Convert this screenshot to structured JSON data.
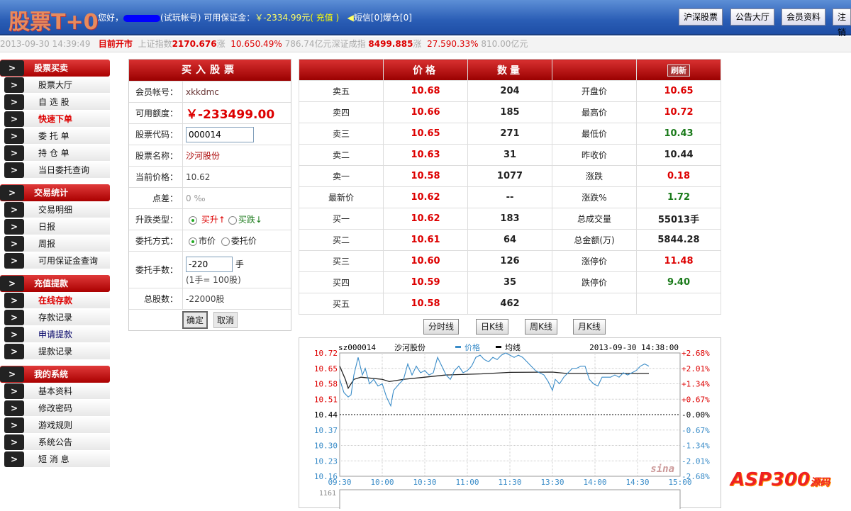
{
  "header": {
    "logo": "股票T+0",
    "greeting": "您好，",
    "account_type": "(试玩帐号)",
    "margin_label": "可用保证金：",
    "margin_value": "￥-2334.99元",
    "recharge": "( 充值 )",
    "messages": "短信[0]",
    "liquidation": "爆仓[0]",
    "buttons": [
      "沪深股票",
      "公告大厅",
      "会员资料",
      "注销"
    ]
  },
  "ticker": {
    "datetime": "2013-09-30 14:39:49",
    "status": "目前开市",
    "sh_label": "上证指数",
    "sh_value": "2170.676",
    "sh_dir": "涨",
    "sh_change": "10.650.49%",
    "sh_volume": "786.74亿元",
    "sz_label": "深证成指",
    "sz_value": "8499.885",
    "sz_dir": "涨",
    "sz_change": "27.590.33%",
    "sz_volume": "810.00亿元"
  },
  "sidebar": [
    {
      "title": "股票买卖",
      "items": [
        {
          "label": "股票大厅"
        },
        {
          "label": "自 选 股"
        },
        {
          "label": "快速下单",
          "style": "red"
        },
        {
          "label": "委 托 单"
        },
        {
          "label": "持 仓 单"
        },
        {
          "label": "当日委托查询"
        }
      ]
    },
    {
      "title": "交易统计",
      "items": [
        {
          "label": "交易明细"
        },
        {
          "label": "日报"
        },
        {
          "label": "周报"
        },
        {
          "label": "可用保证金查询"
        }
      ]
    },
    {
      "title": "充值提款",
      "items": [
        {
          "label": "在线存款",
          "style": "red"
        },
        {
          "label": "存款记录"
        },
        {
          "label": "申请提款",
          "style": "blue"
        },
        {
          "label": "提款记录"
        }
      ]
    },
    {
      "title": "我的系统",
      "items": [
        {
          "label": "基本资料"
        },
        {
          "label": "修改密码"
        },
        {
          "label": "游戏规则"
        },
        {
          "label": "系统公告"
        },
        {
          "label": "短 消 息"
        }
      ]
    }
  ],
  "buy": {
    "title": "买入股票",
    "account_label": "会员帐号：",
    "account": "xkkdmc",
    "quota_label": "可用额度：",
    "quota": "￥-233499.00",
    "code_label": "股票代码：",
    "code": "000014",
    "name_label": "股票名称：",
    "name": "沙河股份",
    "price_label": "当前价格：",
    "price": "10.62",
    "spread_label": "点差：",
    "spread": "0 ‰",
    "type_label": "升跌类型：",
    "type_up": "买升↑",
    "type_down": "买跌↓",
    "method_label": "委托方式：",
    "method_market": "市价",
    "method_limit": "委托价",
    "lots_label": "委托手数：",
    "lots": "-220",
    "lots_unit": "手",
    "lots_note": "(1手= 100股)",
    "total_label": "总股数：",
    "total": "-22000股",
    "confirm": "确定",
    "cancel": "取消"
  },
  "quote": {
    "headers": [
      "",
      "价格",
      "数量",
      "",
      "刷新"
    ],
    "rows": [
      {
        "l": "卖五",
        "p": "10.68",
        "q": "204",
        "k": "开盘价",
        "v": "10.65",
        "c": "pr"
      },
      {
        "l": "卖四",
        "p": "10.66",
        "q": "185",
        "k": "最高价",
        "v": "10.72",
        "c": "pr"
      },
      {
        "l": "卖三",
        "p": "10.65",
        "q": "271",
        "k": "最低价",
        "v": "10.43",
        "c": "pg"
      },
      {
        "l": "卖二",
        "p": "10.63",
        "q": "31",
        "k": "昨收价",
        "v": "10.44",
        "c": "pk"
      },
      {
        "l": "卖一",
        "p": "10.58",
        "q": "1077",
        "k": "涨跌",
        "v": "0.18",
        "c": "pr"
      },
      {
        "l": "最新价",
        "p": "10.62",
        "q": "--",
        "k": "涨跌%",
        "v": "1.72",
        "c": "pg"
      },
      {
        "l": "买一",
        "p": "10.62",
        "q": "183",
        "k": "总成交量",
        "v": "55013手",
        "c": "pk"
      },
      {
        "l": "买二",
        "p": "10.61",
        "q": "64",
        "k": "总金额(万)",
        "v": "5844.28",
        "c": "pk"
      },
      {
        "l": "买三",
        "p": "10.60",
        "q": "126",
        "k": "涨停价",
        "v": "11.48",
        "c": "pr"
      },
      {
        "l": "买四",
        "p": "10.59",
        "q": "35",
        "k": "跌停价",
        "v": "9.40",
        "c": "pg"
      },
      {
        "l": "买五",
        "p": "10.58",
        "q": "462",
        "k": "",
        "v": "",
        "c": "pk"
      }
    ]
  },
  "chart_tabs": [
    "分时线",
    "日K线",
    "周K线",
    "月K线"
  ],
  "chart_data": {
    "type": "line",
    "code": "sz000014",
    "name": "沙河股份",
    "legend": [
      "价格",
      "均线"
    ],
    "datetime": "2013-09-30 14:38:00",
    "y_ticks": [
      "10.72",
      "10.65",
      "10.58",
      "10.51",
      "10.44",
      "10.37",
      "10.30",
      "10.23",
      "10.16"
    ],
    "pct_ticks": [
      "+2.68%",
      "+2.01%",
      "+1.34%",
      "+0.67%",
      "-0.00%",
      "-0.67%",
      "-1.34%",
      "-2.01%",
      "-2.68%"
    ],
    "x_ticks": [
      "09:30",
      "10:00",
      "10:30",
      "11:00",
      "11:30",
      "13:30",
      "14:00",
      "14:30",
      "15:00"
    ],
    "ylim": [
      10.16,
      10.72
    ],
    "prev_close": 10.44,
    "volume_max": "1161",
    "watermark": "sina",
    "price": [
      [
        0,
        10.6
      ],
      [
        3,
        10.54
      ],
      [
        6,
        10.52
      ],
      [
        8,
        10.53
      ],
      [
        10,
        10.62
      ],
      [
        13,
        10.7
      ],
      [
        16,
        10.62
      ],
      [
        18,
        10.65
      ],
      [
        21,
        10.58
      ],
      [
        24,
        10.6
      ],
      [
        27,
        10.57
      ],
      [
        30,
        10.58
      ],
      [
        33,
        10.52
      ],
      [
        36,
        10.48
      ],
      [
        38,
        10.55
      ],
      [
        42,
        10.58
      ],
      [
        45,
        10.6
      ],
      [
        48,
        10.67
      ],
      [
        51,
        10.62
      ],
      [
        54,
        10.66
      ],
      [
        57,
        10.63
      ],
      [
        60,
        10.64
      ],
      [
        63,
        10.62
      ],
      [
        66,
        10.63
      ],
      [
        69,
        10.7
      ],
      [
        72,
        10.66
      ],
      [
        75,
        10.62
      ],
      [
        78,
        10.6
      ],
      [
        81,
        10.64
      ],
      [
        84,
        10.66
      ],
      [
        87,
        10.63
      ],
      [
        90,
        10.64
      ],
      [
        93,
        10.66
      ],
      [
        96,
        10.7
      ],
      [
        99,
        10.71
      ],
      [
        102,
        10.69
      ],
      [
        105,
        10.68
      ],
      [
        108,
        10.7
      ],
      [
        111,
        10.69
      ],
      [
        114,
        10.71
      ],
      [
        117,
        10.72
      ],
      [
        120,
        10.71
      ],
      [
        123,
        10.7
      ],
      [
        126,
        10.71
      ],
      [
        129,
        10.7
      ],
      [
        132,
        10.68
      ],
      [
        135,
        10.66
      ],
      [
        138,
        10.64
      ],
      [
        141,
        10.63
      ],
      [
        144,
        10.62
      ],
      [
        147,
        10.59
      ],
      [
        150,
        10.55
      ],
      [
        152,
        10.6
      ],
      [
        155,
        10.58
      ],
      [
        158,
        10.61
      ],
      [
        161,
        10.63
      ],
      [
        164,
        10.65
      ],
      [
        167,
        10.65
      ],
      [
        170,
        10.66
      ],
      [
        173,
        10.66
      ],
      [
        176,
        10.6
      ],
      [
        179,
        10.58
      ],
      [
        182,
        10.57
      ],
      [
        185,
        10.61
      ],
      [
        188,
        10.61
      ],
      [
        191,
        10.61
      ],
      [
        194,
        10.62
      ],
      [
        197,
        10.61
      ],
      [
        200,
        10.63
      ],
      [
        203,
        10.62
      ],
      [
        206,
        10.63
      ],
      [
        209,
        10.64
      ],
      [
        212,
        10.66
      ],
      [
        215,
        10.67
      ],
      [
        218,
        10.66
      ]
    ],
    "average": [
      [
        0,
        10.66
      ],
      [
        4,
        10.6
      ],
      [
        6,
        10.56
      ],
      [
        10,
        10.6
      ],
      [
        15,
        10.61
      ],
      [
        30,
        10.6
      ],
      [
        35,
        10.59
      ],
      [
        45,
        10.6
      ],
      [
        60,
        10.61
      ],
      [
        75,
        10.62
      ],
      [
        100,
        10.625
      ],
      [
        120,
        10.632
      ],
      [
        150,
        10.633
      ],
      [
        160,
        10.627
      ],
      [
        218,
        10.627
      ]
    ]
  },
  "watermark": "ASP300源码"
}
